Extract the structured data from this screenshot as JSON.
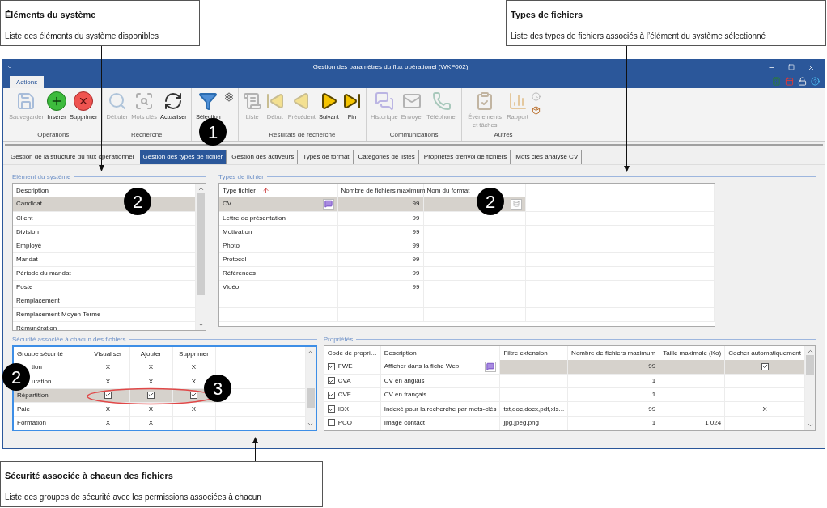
{
  "callouts": [
    {
      "title": "Éléments du système",
      "text": "Liste des éléments du système disponibles"
    },
    {
      "title": "Types de fichiers",
      "text": "Liste des types de fichiers associés à l’élément du système sélectionné"
    },
    {
      "title": "Sécurité associée à chacun des fichiers",
      "text": "Liste des groupes de sécurité avec les permissions associées à chacun"
    }
  ],
  "markers": [
    {
      "label": "1"
    },
    {
      "label": "2"
    },
    {
      "label": "2"
    },
    {
      "label": "2"
    },
    {
      "label": "3"
    }
  ],
  "window": {
    "title": "Gestion des paramètres du flux opérationel (WKF002)"
  },
  "ribbon_tabs": [
    {
      "label": "Actions",
      "selected": true
    }
  ],
  "ribbon_groups": [
    {
      "label": "Opérations",
      "buttons": [
        {
          "kind": "save",
          "label": "Sauvegarder",
          "disabled": true
        },
        {
          "kind": "insert",
          "label": "Insérer",
          "disabled": false
        },
        {
          "kind": "delete",
          "label": "Supprimer",
          "disabled": false
        }
      ]
    },
    {
      "label": "Recherche",
      "buttons": [
        {
          "kind": "search",
          "label": "Débuter",
          "disabled": true
        },
        {
          "kind": "keywords",
          "label": "Mots clés",
          "disabled": true
        },
        {
          "kind": "refresh",
          "label": "Actualiser",
          "disabled": false
        }
      ]
    },
    {
      "buttons": [
        {
          "kind": "filter",
          "label": "Sélection",
          "disabled": false
        },
        {
          "kind": "gear",
          "disabled": false
        }
      ]
    },
    {
      "label": "Résultats de recherche",
      "buttons": [
        {
          "kind": "list",
          "label": "Liste",
          "disabled": true
        },
        {
          "kind": "first",
          "label": "Début",
          "disabled": true
        },
        {
          "kind": "previous",
          "label": "Précédent",
          "disabled": true
        },
        {
          "kind": "next",
          "label": "Suivant",
          "disabled": false
        },
        {
          "kind": "last",
          "label": "Fin",
          "disabled": false
        }
      ]
    },
    {
      "label": "Communications",
      "buttons": [
        {
          "kind": "history",
          "label": "Historique",
          "disabled": true
        },
        {
          "kind": "send",
          "label": "Envoyer",
          "disabled": true
        },
        {
          "kind": "phone",
          "label": "Téléphoner",
          "disabled": true
        }
      ]
    },
    {
      "label": "Autres",
      "buttons": [
        {
          "kind": "events",
          "label": "Événements et tâches",
          "disabled": true
        },
        {
          "kind": "report",
          "label": "Rapport",
          "disabled": true
        },
        {
          "kind": "clock",
          "disabled": true
        },
        {
          "kind": "box",
          "disabled": false
        }
      ]
    }
  ],
  "tabs": [
    {
      "label": "Gestion de la structure du flux opérationnel",
      "selected": false
    },
    {
      "label": "Gestion des types de fichier",
      "selected": true
    },
    {
      "label": "Gestion des activeurs",
      "selected": false
    },
    {
      "label": "Types de format",
      "selected": false
    },
    {
      "label": "Catégories de listes",
      "selected": false
    },
    {
      "label": "Propriétés d'envoi de fichiers",
      "selected": false
    },
    {
      "label": "Mots clés analyse CV",
      "selected": false
    }
  ],
  "system_elements": {
    "title": "Elément du système",
    "columns": [
      "Description"
    ],
    "rows": [
      {
        "label": "Candidat",
        "selected": true
      },
      {
        "label": "Client",
        "selected": false
      },
      {
        "label": "Division",
        "selected": false
      },
      {
        "label": "Employé",
        "selected": false
      },
      {
        "label": "Mandat",
        "selected": false
      },
      {
        "label": "Période du mandat",
        "selected": false
      },
      {
        "label": "Poste",
        "selected": false
      },
      {
        "label": "Remplacement",
        "selected": false
      },
      {
        "label": "Remplacement Moyen Terme",
        "selected": false
      },
      {
        "label": "Rémunération",
        "selected": false
      }
    ]
  },
  "file_types": {
    "title": "Types de fichier",
    "columns": [
      "Type fichier",
      "Nombre de fichiers maximum",
      "Nom du format"
    ],
    "rows": [
      {
        "type": "CV",
        "max": "99",
        "selected": true
      },
      {
        "type": "Lettre de présentation",
        "max": "99",
        "selected": false
      },
      {
        "type": "Motivation",
        "max": "99",
        "selected": false
      },
      {
        "type": "Photo",
        "max": "99",
        "selected": false
      },
      {
        "type": "Protocol",
        "max": "99",
        "selected": false
      },
      {
        "type": "Références",
        "max": "99",
        "selected": false
      },
      {
        "type": "Vidéo",
        "max": "99",
        "selected": false
      }
    ]
  },
  "security": {
    "title": "Sécurité associée à chacun des fichiers",
    "columns": [
      "Groupe sécurité",
      "Visualiser",
      "Ajouter",
      "Supprimer"
    ],
    "rows": [
      {
        "selected": false,
        "cells": [
          {
            "kind": "text",
            "text": "tion"
          },
          {
            "kind": "text",
            "text": "X"
          },
          {
            "kind": "text",
            "text": "X"
          },
          {
            "kind": "text",
            "text": "X"
          }
        ]
      },
      {
        "selected": false,
        "cells": [
          {
            "kind": "text",
            "text": "uration"
          },
          {
            "kind": "text",
            "text": "X"
          },
          {
            "kind": "text",
            "text": "X"
          },
          {
            "kind": "text",
            "text": "X"
          }
        ]
      },
      {
        "selected": true,
        "cells": [
          {
            "kind": "text",
            "text": "Répartition"
          },
          {
            "kind": "checkbox",
            "checked": true
          },
          {
            "kind": "checkbox",
            "checked": true
          },
          {
            "kind": "checkbox",
            "checked": true
          }
        ]
      },
      {
        "selected": false,
        "cells": [
          {
            "kind": "text",
            "text": "Paie"
          },
          {
            "kind": "text",
            "text": "X"
          },
          {
            "kind": "text",
            "text": "X"
          },
          {
            "kind": "text",
            "text": "X"
          }
        ]
      },
      {
        "selected": false,
        "cells": [
          {
            "kind": "text",
            "text": "Formation"
          },
          {
            "kind": "text",
            "text": "X"
          },
          {
            "kind": "text",
            "text": "X"
          }
        ]
      }
    ]
  },
  "properties": {
    "title": "Propriétés",
    "columns": [
      "Code de propri…",
      "Description",
      "Filtre extension",
      "Nombre de fichiers maximum",
      "Taille maximale (Ko)",
      "Cocher automatiquement"
    ],
    "rows": [
      {
        "checked": true,
        "code": "FWE",
        "description": "Afficher dans la fiche Web",
        "max": "99",
        "selected": true,
        "auto": {
          "kind": "checkbox",
          "checked": true
        }
      },
      {
        "checked": true,
        "code": "CVA",
        "description": "CV en anglais",
        "max": "1",
        "selected": false
      },
      {
        "checked": true,
        "code": "CVF",
        "description": "CV en français",
        "max": "1",
        "selected": false
      },
      {
        "checked": true,
        "code": "IDX",
        "description": "Indexé pour la recherche par mots-clés",
        "extension": "txt,doc,docx,pdf,xls...",
        "max": "99",
        "selected": false,
        "auto": {
          "kind": "text",
          "text": "X"
        }
      },
      {
        "checked": false,
        "code": "PCO",
        "description": "Image contact",
        "extension": "jpg,jpeg,png",
        "max": "1",
        "size": "1 024",
        "selected": false
      }
    ]
  }
}
